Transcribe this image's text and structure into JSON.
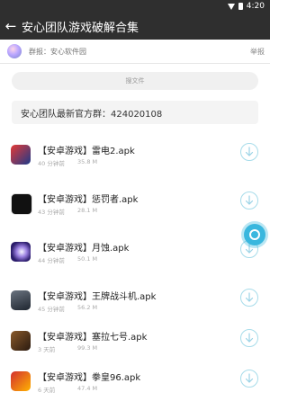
{
  "status_bar": {
    "time": "4:20"
  },
  "toolbar": {
    "title": "安心团队游戏破解合集"
  },
  "group": {
    "text": "群报：安心软件园",
    "report_label": "举报"
  },
  "search": {
    "placeholder": "搜文件"
  },
  "notice": {
    "text": "安心团队最新官方群：424020108"
  },
  "files": [
    {
      "name": "【安卓游戏】雷电2.apk",
      "time": "40 分钟前",
      "size": "35.8 M"
    },
    {
      "name": "【安卓游戏】惩罚者.apk",
      "time": "43 分钟前",
      "size": "28.1 M"
    },
    {
      "name": "【安卓游戏】月蚀.apk",
      "time": "44 分钟前",
      "size": "50.1 M"
    },
    {
      "name": "【安卓游戏】王牌战斗机.apk",
      "time": "45 分钟前",
      "size": "56.2 M"
    },
    {
      "name": "【安卓游戏】塞拉七号.apk",
      "time": "3 天前",
      "size": "99.3 M"
    },
    {
      "name": "【安卓游戏】拳皇96.apk",
      "time": "6 天前",
      "size": "47.4 M"
    }
  ],
  "colors": {
    "toolbar_bg": "#2f2f2f",
    "accent": "#3ab7de"
  }
}
